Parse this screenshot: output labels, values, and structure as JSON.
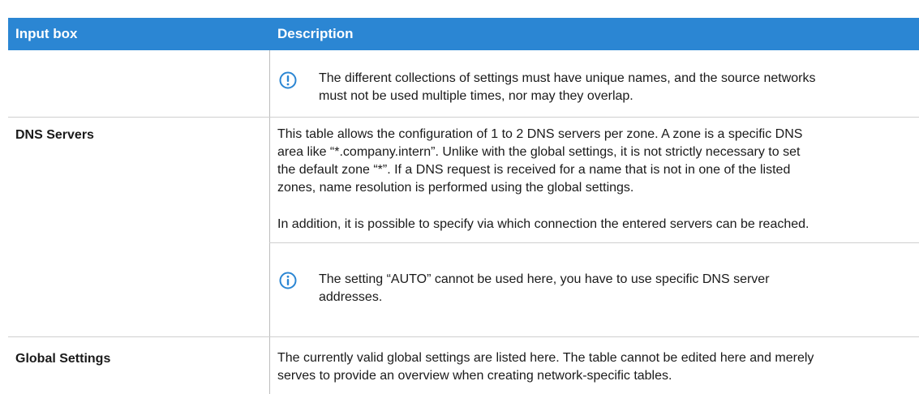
{
  "table": {
    "header": {
      "col1": "Input box",
      "col2": "Description"
    },
    "rows": [
      {
        "note_warning": [
          "The different collections of settings must have unique names, and the source networks",
          "must not be used multiple times, nor may they overlap."
        ]
      },
      {
        "label": "DNS Servers",
        "para1": [
          "This table allows the configuration of 1 to 2 DNS servers per zone. A zone is a specific DNS",
          "area like “*.company.intern”. Unlike with the global settings, it is not strictly necessary to set",
          "the default zone “*”. If a DNS request is received for a name that is not in one of the listed",
          "zones, name resolution is performed using the global settings."
        ],
        "para2": "In addition, it is possible to specify via which connection the entered servers can be reached.",
        "note_info": [
          "The setting “AUTO” cannot be used here, you have to use specific DNS server",
          "addresses."
        ]
      },
      {
        "label": "Global Settings",
        "para1": [
          "The currently valid global settings are listed here. The table cannot be edited here and merely",
          "serves to provide an overview when creating network-specific tables."
        ]
      }
    ]
  },
  "icons": {
    "warning": "exclamation-circle-icon",
    "info": "info-circle-icon"
  },
  "colors": {
    "header_bg": "#2b86d3",
    "icon": "#2b86d3",
    "rule": "#cfcfcf"
  }
}
